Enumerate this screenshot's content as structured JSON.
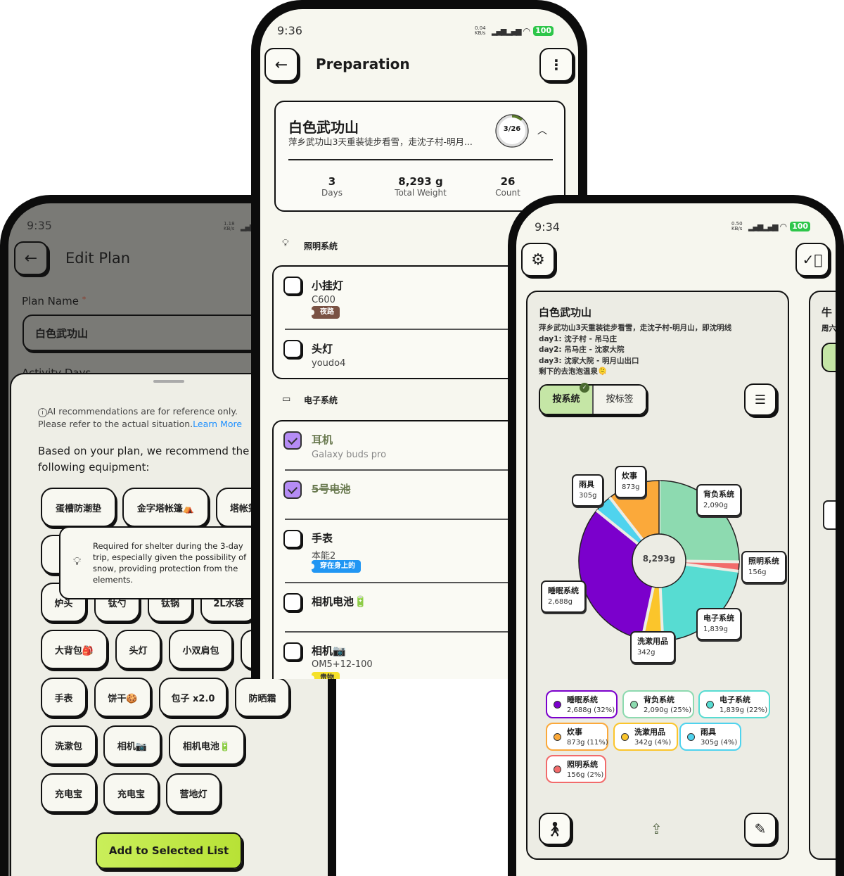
{
  "left_phone": {
    "time": "9:35",
    "net_speed": "1.18 KB/s",
    "title": "Edit Plan",
    "plan_name_label": "Plan Name",
    "required_mark": "*",
    "plan_name_value": "白色武功山",
    "activity_days_label": "Activity Days",
    "sheet": {
      "notice": "AI recommendations are for reference only. Please refer to the actual situation.",
      "learn_more": "Learn More",
      "intro": "Based on your plan, we recommend the following equipment:",
      "tooltip": "Required for shelter during the 3-day trip, especially given the possibility of snow, providing protection from the elements.",
      "chips_row1": [
        "蛋槽防潮垫",
        "金字塔帐篷⛺",
        "塔帐篷"
      ],
      "chips_row3": [
        "炉头",
        "钛勺",
        "钛锅",
        "2L水袋"
      ],
      "chips_row4": [
        "大背包🎒",
        "头灯",
        "小双肩包"
      ],
      "chips_row5": [
        "手表",
        "饼干🍪",
        "包子 x2.0",
        "防晒霜"
      ],
      "chips_row6": [
        "洗漱包",
        "相机📷",
        "相机电池🔋"
      ],
      "chips_row7": [
        "充电宝",
        "充电宝",
        "营地灯"
      ],
      "add_button": "Add to Selected List"
    }
  },
  "middle_phone": {
    "time": "9:36",
    "net_speed": "0.04 KB/s",
    "battery": "100",
    "title": "Preparation",
    "summary": {
      "title": "白色武功山",
      "subtitle": "萍乡武功山3天重装徒步看雪，走沈子村-明月...",
      "progress_label": "3/26",
      "progress_fraction": 0.115,
      "stats": [
        {
          "value": "3",
          "label": "Days"
        },
        {
          "value": "8,293 g",
          "label": "Total Weight"
        },
        {
          "value": "26",
          "label": "Count"
        }
      ]
    },
    "sections": [
      {
        "name": "照明系统",
        "icon": "lightbulb-icon",
        "items": [
          {
            "name": "小挂灯",
            "sub": "C600",
            "tag": "夜路",
            "tag_color": "#7a5244",
            "checked": false
          },
          {
            "name": "头灯",
            "sub": "youdo4",
            "checked": false
          }
        ]
      },
      {
        "name": "电子系统",
        "icon": "devices-icon",
        "items": [
          {
            "name": "耳机",
            "sub": "Galaxy buds pro",
            "checked": true
          },
          {
            "name": "5号电池",
            "checked": true
          },
          {
            "name": "手表",
            "sub": "本能2",
            "tag": "穿在身上的",
            "tag_color": "#2196f3",
            "checked": false
          },
          {
            "name": "相机电池🔋",
            "checked": false
          },
          {
            "name": "相机📷",
            "sub": "OM5+12-100",
            "tag": "贵物",
            "tag_color": "#f5e12a",
            "checked": false
          }
        ]
      }
    ]
  },
  "right_phone": {
    "time": "9:34",
    "net_speed": "0.50 KB/s",
    "battery": "100",
    "card": {
      "title": "白色武功山",
      "description": [
        "萍乡武功山3天重装徒步看雪，走沈子村-明月山，即沈明线",
        "day1: 沈子村 - 吊马庄",
        "day2: 吊马庄 - 沈家大院",
        "day3: 沈家大院 - 明月山出口",
        "剩下的去泡泡温泉🫠"
      ],
      "seg_by_system": "按系统",
      "seg_by_tag": "按标签",
      "seg_selected": "按系统"
    },
    "peek_card": {
      "title": "牛",
      "sub": "周六"
    },
    "accent": "#c5e6a6"
  },
  "chart_data": {
    "type": "pie",
    "donut": true,
    "center_label": "8,293g",
    "categories": [
      "背负系统",
      "照明系统",
      "电子系统",
      "洗漱用品",
      "睡眠系统",
      "雨具",
      "炊事"
    ],
    "values": [
      2090,
      156,
      1839,
      342,
      2688,
      305,
      873
    ],
    "value_labels": [
      "2,090g",
      "156g",
      "1,839g",
      "342g",
      "2,688g",
      "305g",
      "873g"
    ],
    "colors": [
      "#8ddab0",
      "#f26b6b",
      "#57dcd2",
      "#fbc52b",
      "#7b00cc",
      "#4fd3ee",
      "#fba93a"
    ],
    "legend": [
      {
        "name": "睡眠系统",
        "value": "2,688g (32%)",
        "color": "#7b00cc"
      },
      {
        "name": "背负系统",
        "value": "2,090g (25%)",
        "color": "#8ddab0"
      },
      {
        "name": "电子系统",
        "value": "1,839g (22%)",
        "color": "#57dcd2"
      },
      {
        "name": "炊事",
        "value": "873g (11%)",
        "color": "#fba93a"
      },
      {
        "name": "洗漱用品",
        "value": "342g (4%)",
        "color": "#fbc52b"
      },
      {
        "name": "雨具",
        "value": "305g (4%)",
        "color": "#4fd3ee"
      },
      {
        "name": "照明系统",
        "value": "156g (2%)",
        "color": "#f26b6b"
      }
    ]
  }
}
